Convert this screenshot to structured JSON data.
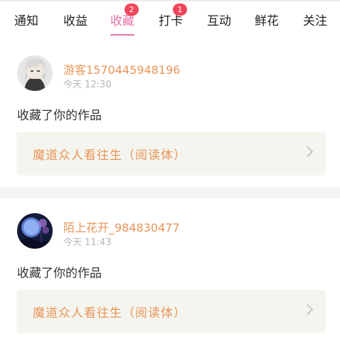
{
  "tabs": [
    {
      "label": "通知"
    },
    {
      "label": "收益"
    },
    {
      "label": "收藏",
      "badge": "2",
      "active": true
    },
    {
      "label": "打卡",
      "badge": "1"
    },
    {
      "label": "互动"
    },
    {
      "label": "鲜花"
    },
    {
      "label": "关注"
    }
  ],
  "feed": [
    {
      "username": "游客1570445948196",
      "time": "今天 12:30",
      "action": "收藏了你的作品",
      "work_title": "魔道众人看往生（阅读体）",
      "avatar_icon": "anime-avatar-white-hair"
    },
    {
      "username": "陌上花开_984830477",
      "time": "今天 11:43",
      "action": "收藏了你的作品",
      "work_title": "魔道众人看往生（阅读体）",
      "avatar_icon": "night-moon-avatar"
    }
  ],
  "colors": {
    "accent": "#e870a8",
    "badge": "#f0455a",
    "username": "#e8955a",
    "card_bg": "#f5f5ef"
  }
}
